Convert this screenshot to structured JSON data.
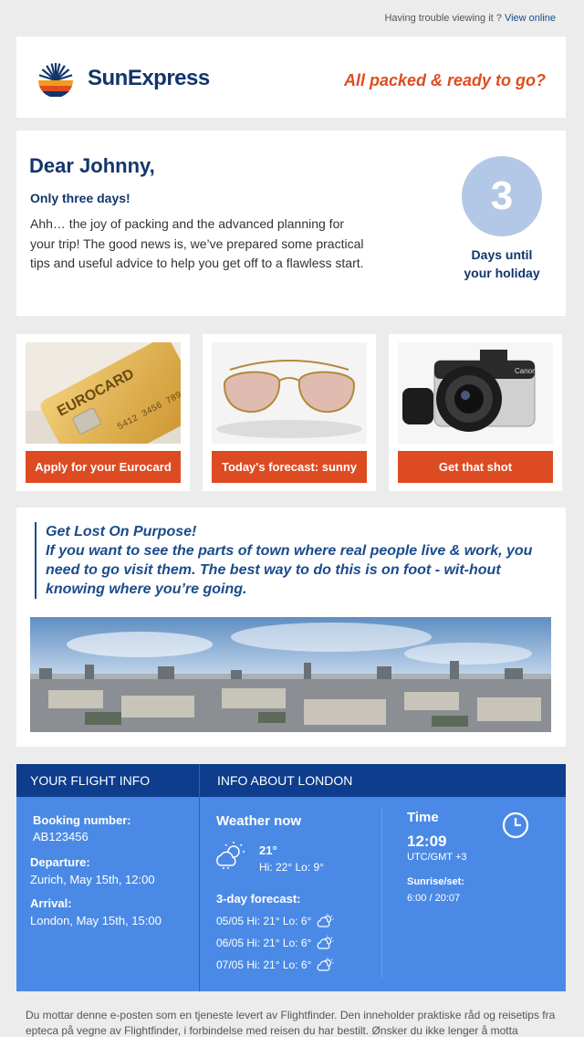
{
  "topbar": {
    "text": "Having trouble viewing it ?",
    "link": "View online"
  },
  "header": {
    "brand": "SunExpress",
    "tagline": "All packed & ready to go?"
  },
  "greeting": {
    "salutation": "Dear Johnny,",
    "subheading": "Only three days!",
    "body": "Ahh… the joy of packing and the advanced planning for your trip! The good news is, we’ve prepared some practical tips and useful advice to help you get off to a flawless start.",
    "days_count": "3",
    "days_label_line1": "Days until",
    "days_label_line2": "your holiday"
  },
  "tiles": [
    {
      "button": "Apply for your Eurocard",
      "image": "credit-card-image",
      "card_text": "EUROCARD"
    },
    {
      "button": "Today's forecast: sunny",
      "image": "sunglasses-image"
    },
    {
      "button": "Get that shot",
      "image": "camera-image",
      "camera_brand": "Canon"
    }
  ],
  "quote": {
    "title": "Get Lost On Purpose!",
    "body": " If you want to see the parts of town where real people live & work, you need to go visit them. The best way to do this is on foot - wit-hout knowing where you’re going."
  },
  "flight_info": {
    "heading": "YOUR FLIGHT INFO",
    "booking_label": "Booking number:",
    "booking_value": "AB123456",
    "departure_label": "Departure:",
    "departure_value": "Zurich, May 15th, 12:00",
    "arrival_label": "Arrival:",
    "arrival_value": "London, May 15th, 15:00"
  },
  "city_info": {
    "heading": "INFO ABOUT LONDON",
    "weather_label": "Weather now",
    "current_temp": "21°",
    "current_hilo": "Hi: 22° Lo: 9°",
    "forecast_label": "3-day forecast:",
    "forecast": [
      {
        "text": "05/05 Hi: 21° Lo: 6°",
        "icon": "partly-cloudy-icon"
      },
      {
        "text": "06/05 Hi: 21° Lo: 6°",
        "icon": "partly-cloudy-icon"
      },
      {
        "text": "07/05 Hi: 21° Lo: 6°",
        "icon": "partly-cloudy-icon"
      }
    ],
    "time_label": "Time",
    "time_value": "12:09",
    "timezone": "UTC/GMT +3",
    "sun_label": "Sunrise/set:",
    "sun_value": "6:00 / 20:07"
  },
  "footer": {
    "text": "Du mottar denne e-posten som en tjeneste levert av Flightfinder. Den inneholder praktiske råd og reisetips fra epteca på vegne av Flightfinder, i forbindelse med reisen du har bestilt. Ønsker du ikke lenger å motta"
  },
  "colors": {
    "brand_navy": "#12356b",
    "accent_orange": "#dd4b22",
    "info_blue": "#4a8ae6",
    "info_dark": "#0d3d8c"
  }
}
